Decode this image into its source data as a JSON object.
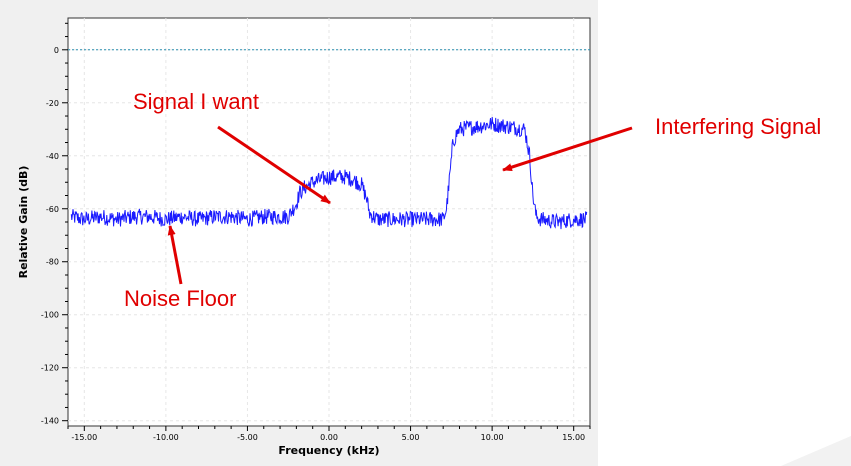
{
  "chart_data": {
    "type": "line",
    "title": "",
    "xlabel": "Frequency (kHz)",
    "ylabel": "Relative Gain (dB)",
    "xlim": [
      -16,
      16
    ],
    "ylim": [
      -142,
      12
    ],
    "x_ticks": [
      -15,
      -10,
      -5,
      0,
      5,
      10,
      15
    ],
    "x_tick_labels": [
      "-15.00",
      "-10.00",
      "-5.00",
      "0.00",
      "5.00",
      "10.00",
      "15.00"
    ],
    "y_ticks": [
      0,
      -20,
      -40,
      -60,
      -80,
      -100,
      -120,
      -140
    ],
    "y_tick_labels": [
      "0",
      "-20",
      "-40",
      "-60",
      "-80",
      "-100",
      "-120",
      "-140"
    ],
    "grid": true,
    "reference_line": {
      "y": 0,
      "color": "#2a8fb0",
      "style": "dotted"
    },
    "series": [
      {
        "color": "#1a1aff",
        "x": [
          -15.8,
          -15.0,
          -14.0,
          -13.0,
          -12.0,
          -11.0,
          -10.0,
          -9.0,
          -8.0,
          -7.0,
          -6.0,
          -5.0,
          -4.0,
          -3.0,
          -2.5,
          -2.2,
          -2.0,
          -1.8,
          -1.5,
          -1.0,
          -0.5,
          0.0,
          0.5,
          1.0,
          1.5,
          2.0,
          2.3,
          2.5,
          3.0,
          4.0,
          5.0,
          6.0,
          7.0,
          7.2,
          7.4,
          7.6,
          7.8,
          8.0,
          9.0,
          10.0,
          11.0,
          12.0,
          12.3,
          12.5,
          12.7,
          13.0,
          14.0,
          15.0,
          15.8
        ],
        "y": [
          -63,
          -64,
          -63,
          -64,
          -63,
          -63,
          -64,
          -63,
          -64,
          -63,
          -63,
          -64,
          -63,
          -63,
          -63,
          -60,
          -58,
          -54,
          -52,
          -50,
          -49,
          -48,
          -48,
          -48,
          -49,
          -51,
          -56,
          -62,
          -64,
          -64,
          -64,
          -64,
          -64,
          -60,
          -48,
          -35,
          -32,
          -30,
          -29,
          -28,
          -29,
          -30,
          -40,
          -55,
          -63,
          -64,
          -65,
          -64,
          -64
        ]
      }
    ],
    "annotations": [
      {
        "text": "Signal I want",
        "color": "#e00000"
      },
      {
        "text": "Interfering Signal",
        "color": "#e00000"
      },
      {
        "text": "Noise Floor",
        "color": "#e00000"
      }
    ]
  }
}
